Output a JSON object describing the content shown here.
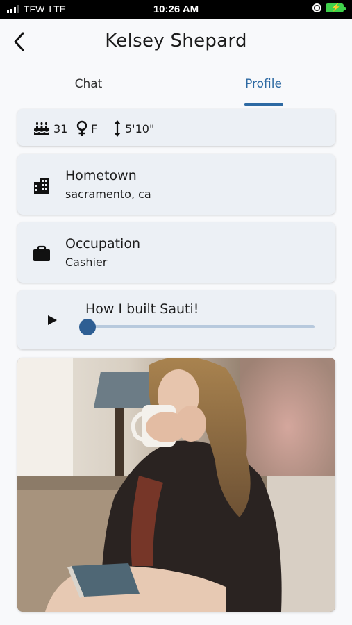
{
  "status_bar": {
    "carrier": "TFW",
    "network": "LTE",
    "time": "10:26 AM"
  },
  "header": {
    "title": "Kelsey Shepard",
    "back_icon": "chevron-left-icon"
  },
  "tabs": [
    {
      "label": "Chat",
      "active": false
    },
    {
      "label": "Profile",
      "active": true
    }
  ],
  "accent_color": "#2e6aa3",
  "stats": {
    "age": "31",
    "gender": "F",
    "height": "5'10\"",
    "icons": [
      "birthday-cake-icon",
      "female-icon",
      "height-icon"
    ]
  },
  "hometown": {
    "label": "Hometown",
    "value": "sacramento, ca",
    "icon": "building-icon"
  },
  "occupation": {
    "label": "Occupation",
    "value": "Cashier",
    "icon": "briefcase-icon"
  },
  "audio": {
    "title": "How I built Sauti!",
    "progress": 0.0,
    "icon": "play-icon"
  },
  "photo": {
    "icon": "profile-photo"
  }
}
